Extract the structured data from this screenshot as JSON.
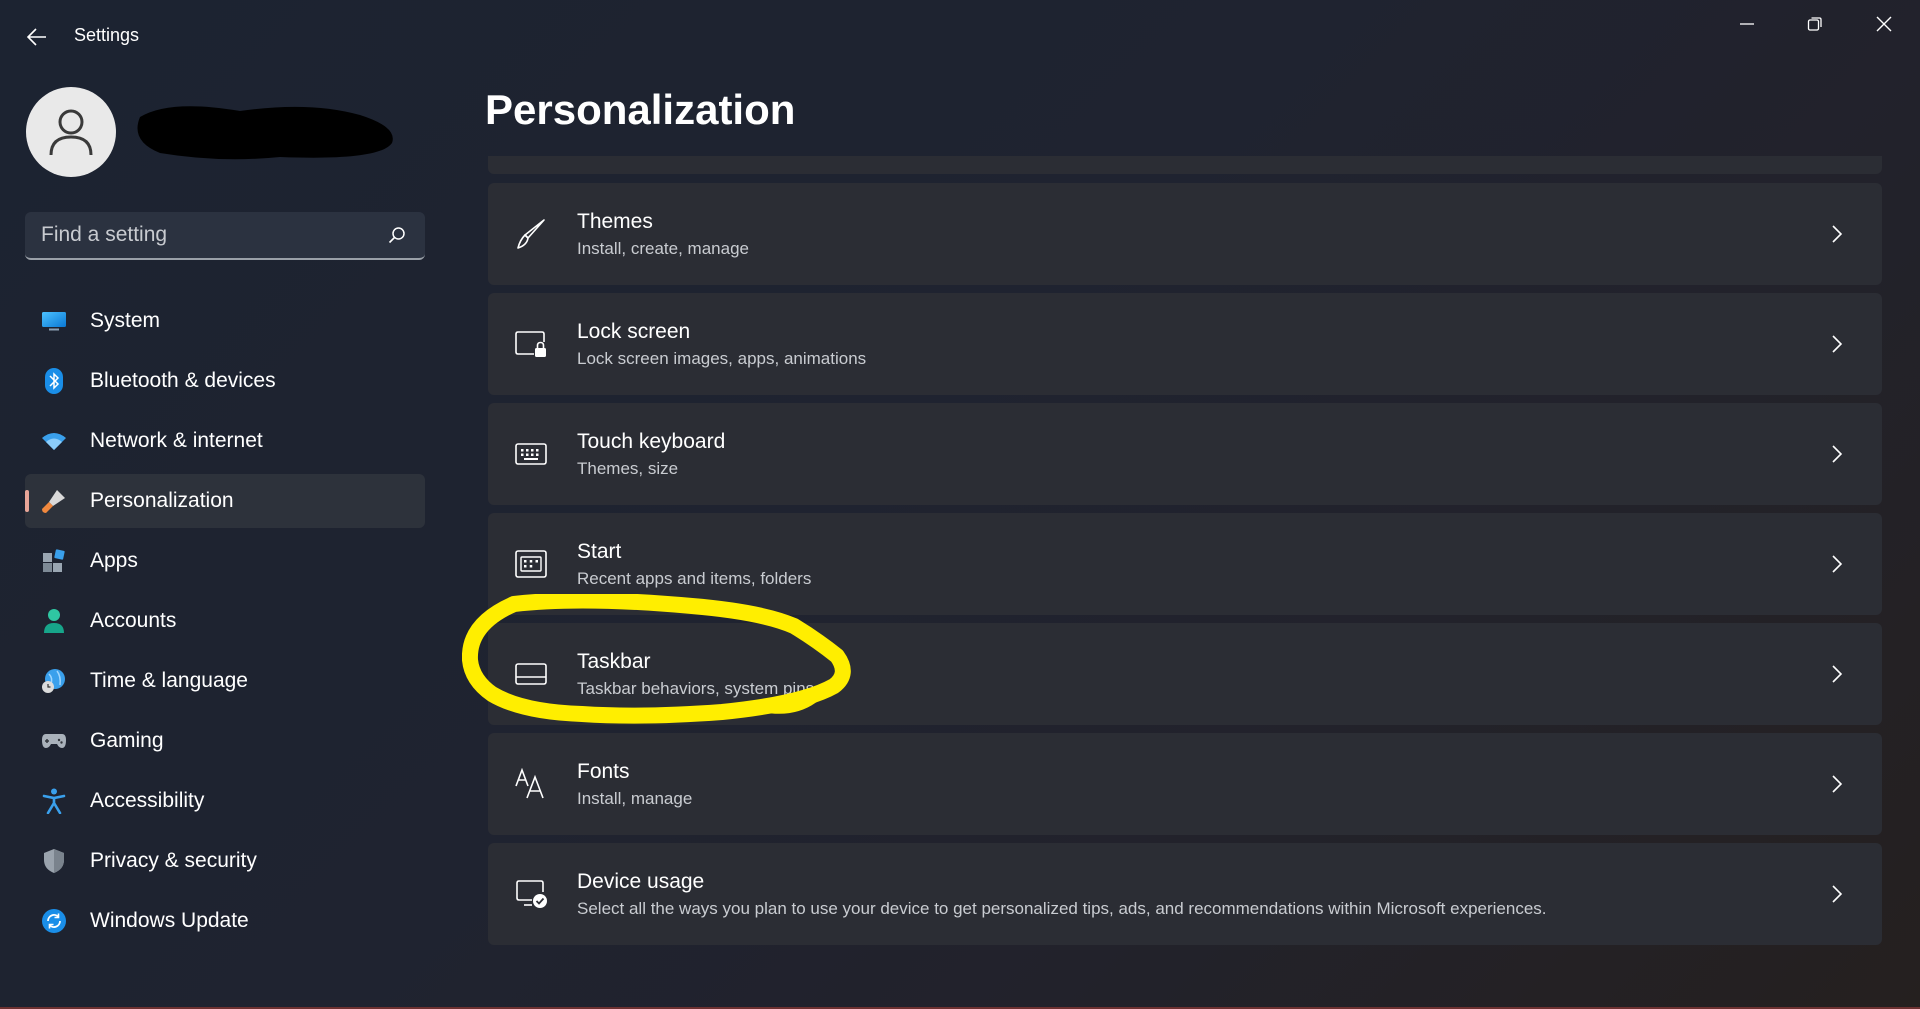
{
  "window": {
    "title": "Settings"
  },
  "search": {
    "placeholder": "Find a setting"
  },
  "sidebar": {
    "items": [
      {
        "label": "System",
        "icon": "monitor-icon"
      },
      {
        "label": "Bluetooth & devices",
        "icon": "bluetooth-icon"
      },
      {
        "label": "Network & internet",
        "icon": "wifi-icon"
      },
      {
        "label": "Personalization",
        "icon": "paintbrush-icon",
        "active": true
      },
      {
        "label": "Apps",
        "icon": "apps-icon"
      },
      {
        "label": "Accounts",
        "icon": "person-icon"
      },
      {
        "label": "Time & language",
        "icon": "globe-clock-icon"
      },
      {
        "label": "Gaming",
        "icon": "gamepad-icon"
      },
      {
        "label": "Accessibility",
        "icon": "accessibility-icon"
      },
      {
        "label": "Privacy & security",
        "icon": "shield-icon"
      },
      {
        "label": "Windows Update",
        "icon": "update-icon"
      }
    ]
  },
  "main": {
    "title": "Personalization",
    "cards": [
      {
        "title": "Themes",
        "subtitle": "Install, create, manage",
        "icon": "brush-icon"
      },
      {
        "title": "Lock screen",
        "subtitle": "Lock screen images, apps, animations",
        "icon": "lock-screen-icon"
      },
      {
        "title": "Touch keyboard",
        "subtitle": "Themes, size",
        "icon": "keyboard-icon"
      },
      {
        "title": "Start",
        "subtitle": "Recent apps and items, folders",
        "icon": "start-menu-icon"
      },
      {
        "title": "Taskbar",
        "subtitle": "Taskbar behaviors, system pins",
        "icon": "taskbar-icon"
      },
      {
        "title": "Fonts",
        "subtitle": "Install, manage",
        "icon": "fonts-icon"
      },
      {
        "title": "Device usage",
        "subtitle": "Select all the ways you plan to use your device to get personalized tips, ads, and recommendations within Microsoft experiences.",
        "icon": "device-usage-icon"
      }
    ]
  },
  "colors": {
    "accent": "#e8a598",
    "annotation": "#ffee00",
    "card_bg": "#2b2d34"
  }
}
